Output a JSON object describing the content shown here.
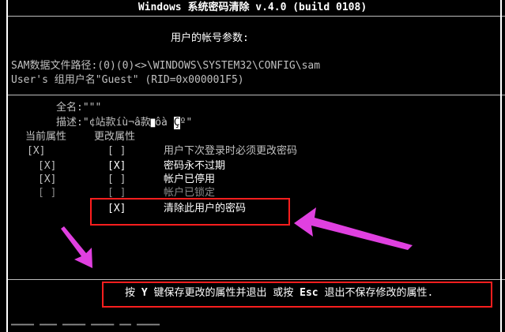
{
  "header": {
    "title": "Windows 系统密码清除 v.4.0 (build 0108)",
    "subtitle": "用户的帐号参数:"
  },
  "sam": {
    "path_line": "SAM数据文件路径:(0)(0)<>\\WINDOWS\\SYSTEM32\\CONFIG\\sam",
    "user_line": "User's 组用户名\"Guest\" (RID=0x000001F5)"
  },
  "account": {
    "full_name": "全名:\"\"\"",
    "description_prefix": "描述:\"¢站款íù¬â款",
    "description_mid": "ôà",
    "description_cursor": "Ç",
    "description_suffix": "º\""
  },
  "attributes": {
    "current_header": "当前属性",
    "change_header": "更改属性",
    "rows": [
      {
        "current": "[X]",
        "change": "[ ]",
        "label": "用户下次登录时必须更改密码"
      },
      {
        "current": "[X]",
        "change": "[X]",
        "label": "密码永不过期"
      },
      {
        "current": "[X]",
        "change": "[ ]",
        "label": "帐户已停用"
      },
      {
        "current": "[ ]",
        "change": "[ ]",
        "label": "帐户已锁定"
      },
      {
        "current": "",
        "change": "[X]",
        "label": "清除此用户的密码"
      }
    ]
  },
  "footer": {
    "pre": "按 ",
    "key1": "Y",
    "mid": " 键保存更改的属性并退出 或按 ",
    "key2": "Esc",
    "post": " 退出不保存修改的属性."
  },
  "colors": {
    "background": "#000000",
    "text": "#c8c8c8",
    "highlight_box": "#ff1e1e",
    "arrow": "#e040e0"
  }
}
